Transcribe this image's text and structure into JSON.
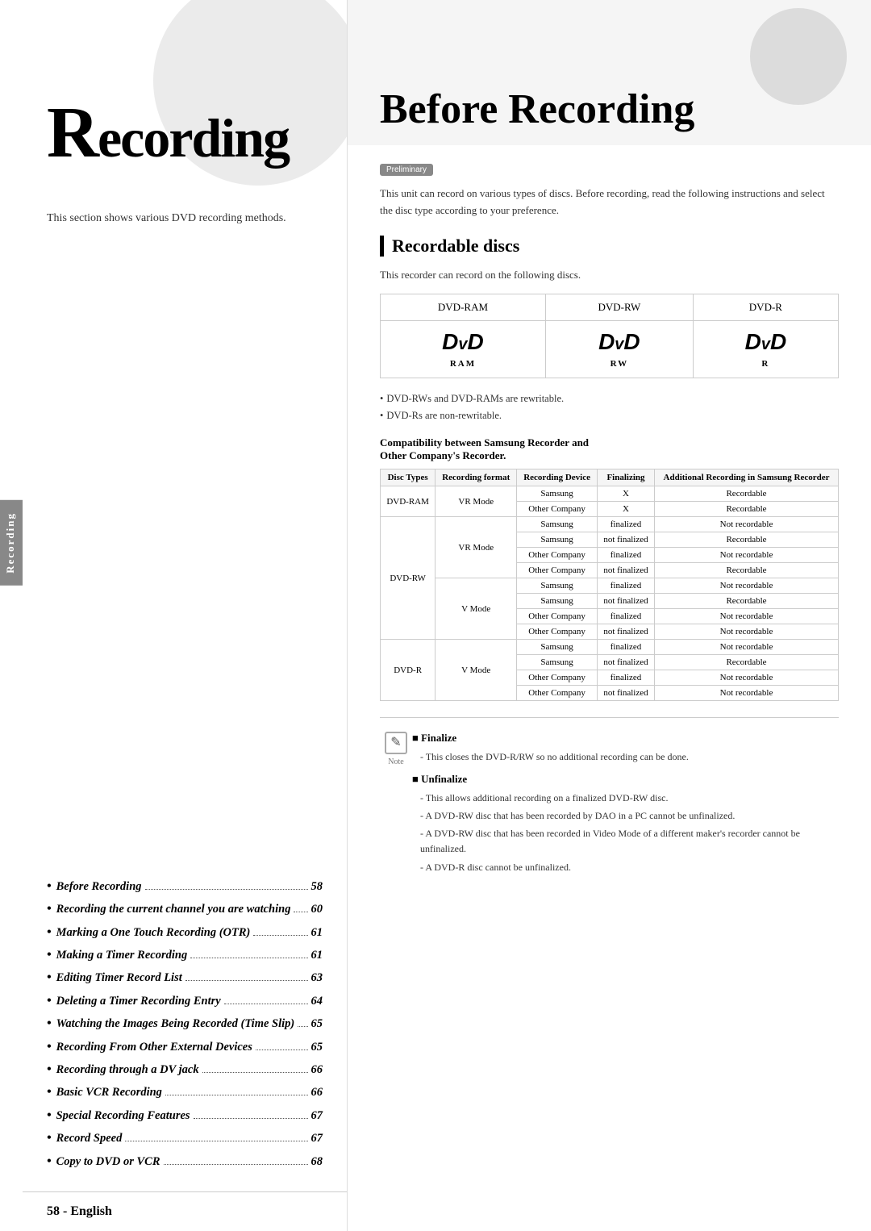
{
  "left": {
    "title": "Recording",
    "big_r": "R",
    "title_rest": "ecording",
    "section_text": "This section shows various DVD recording methods.",
    "toc": [
      {
        "label": "Before Recording",
        "dots": "............",
        "page": "58"
      },
      {
        "label": "Recording the current channel you are watching",
        "dots": "...............",
        "page": "60"
      },
      {
        "label": "Marking a One Touch Recording (OTR)",
        "dots": "...............",
        "page": "61"
      },
      {
        "label": "Making a Timer Recording",
        "dots": "........",
        "page": "61"
      },
      {
        "label": "Editing Timer Record List",
        "dots": ".......",
        "page": "63"
      },
      {
        "label": "Deleting a Timer Recording Entry",
        "dots": "..",
        "page": "64"
      },
      {
        "label": "Watching the Images Being Recorded (Time Slip)",
        "dots": ".............",
        "page": "65"
      },
      {
        "label": "Recording From Other External Devices",
        "dots": "...................",
        "page": "65"
      },
      {
        "label": "Recording through a DV jack",
        "dots": ".......",
        "page": "66"
      },
      {
        "label": "Basic VCR Recording",
        "dots": ".........",
        "page": "66"
      },
      {
        "label": "Special Recording Features",
        "dots": "......",
        "page": "67"
      },
      {
        "label": "Record Speed",
        "dots": "...............",
        "page": "67"
      },
      {
        "label": "Copy to DVD or VCR",
        "dots": ".........",
        "page": "68"
      }
    ],
    "side_tab_label": "Recording",
    "footer": "58 - English"
  },
  "right": {
    "title": "Before Recording",
    "preliminary_badge": "Preliminary",
    "intro": "This unit can record on various types of discs. Before recording, read the following instructions and select the disc type according to your preference.",
    "recordable_discs_title": "Recordable discs",
    "sub_intro": "This recorder can record on the following discs.",
    "disc_columns": [
      "DVD-RAM",
      "DVD-RW",
      "DVD-R"
    ],
    "disc_logos": [
      "DVD RAM",
      "DVD RW",
      "DVD R"
    ],
    "disc_logo_labels": [
      "RAM",
      "RW",
      "R"
    ],
    "bullet_notes": [
      "DVD-RWs and DVD-RAMs are rewritable.",
      "DVD-Rs are non-rewritable."
    ],
    "compat_title_line1": "Compatibility between Samsung Recorder and",
    "compat_title_line2": "Other Company's Recorder.",
    "compat_headers": [
      "Disc Types",
      "Recording format",
      "Recording Device",
      "Finalizing",
      "Additional Recording in Samsung Recorder"
    ],
    "compat_rows": [
      {
        "disc": "DVD-RAM",
        "format": "VR Mode",
        "device": "Samsung",
        "finalizing": "X",
        "additional": "Recordable",
        "rowspan_disc": 2,
        "rowspan_format": 1
      },
      {
        "disc": "",
        "format": "",
        "device": "Other Company",
        "finalizing": "X",
        "additional": "Recordable"
      },
      {
        "disc": "DVD-RW",
        "format": "VR Mode",
        "device": "Samsung",
        "finalizing": "finalized",
        "additional": "Not recordable",
        "rowspan_disc": 8
      },
      {
        "disc": "",
        "format": "",
        "device": "Samsung",
        "finalizing": "not finalized",
        "additional": "Recordable"
      },
      {
        "disc": "",
        "format": "",
        "device": "Other Company",
        "finalizing": "finalized",
        "additional": "Not recordable"
      },
      {
        "disc": "",
        "format": "",
        "device": "Other Company",
        "finalizing": "not finalized",
        "additional": "Recordable"
      },
      {
        "disc": "",
        "format": "V Mode",
        "device": "Samsung",
        "finalizing": "finalized",
        "additional": "Not recordable"
      },
      {
        "disc": "",
        "format": "",
        "device": "Samsung",
        "finalizing": "not finalized",
        "additional": "Recordable"
      },
      {
        "disc": "",
        "format": "",
        "device": "Other Company",
        "finalizing": "finalized",
        "additional": "Not recordable"
      },
      {
        "disc": "",
        "format": "",
        "device": "Other Company",
        "finalizing": "not finalized",
        "additional": "Not recordable"
      },
      {
        "disc": "DVD-R",
        "format": "V Mode",
        "device": "Samsung",
        "finalizing": "finalized",
        "additional": "Not recordable",
        "rowspan_disc": 4
      },
      {
        "disc": "",
        "format": "",
        "device": "Samsung",
        "finalizing": "not finalized",
        "additional": "Recordable"
      },
      {
        "disc": "",
        "format": "",
        "device": "Other Company",
        "finalizing": "finalized",
        "additional": "Not recordable"
      },
      {
        "disc": "",
        "format": "",
        "device": "Other Company",
        "finalizing": "not finalized",
        "additional": "Not recordable"
      }
    ],
    "note_icon": "✎",
    "note_label": "Note",
    "finalize_title": "Finalize",
    "finalize_text": "- This closes the DVD-R/RW so no additional recording can be done.",
    "unfinalize_title": "Unfinalize",
    "unfinalize_items": [
      "- This allows additional recording on a finalized DVD-RW disc.",
      "- A DVD-RW disc that has been recorded by DAO in a PC cannot be unfinalized.",
      "- A DVD-RW disc that has been recorded in Video Mode of a different maker's recorder cannot be unfinalized.",
      "- A DVD-R disc cannot be unfinalized."
    ]
  }
}
